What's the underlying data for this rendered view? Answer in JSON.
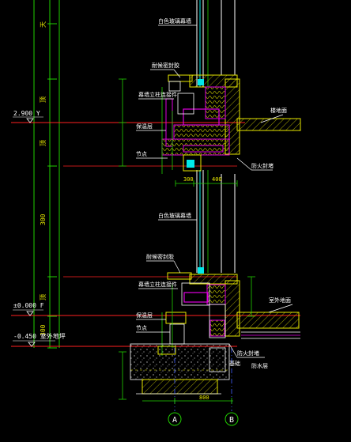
{
  "elevations": {
    "upper": "2.900 Y",
    "middle": "±0.000 F",
    "lower": "-0.450 室外地坪"
  },
  "axes": [
    "A",
    "B"
  ],
  "labels": {
    "glass_top": "白色玻璃幕墙",
    "glass_mid": "白色玻璃幕墙",
    "sealant_top": "耐候密封胶",
    "sealant_bottom": "耐候密封胶",
    "bracket_top": "幕墙立柱连接件",
    "bracket_bottom": "幕墙立柱连接件",
    "insulation_top": "保温层",
    "insulation_bottom": "保温层",
    "joint_top": "节点",
    "joint_bottom": "节点",
    "fire_top": "防火封堵",
    "fire_bottom": "防火封堵",
    "slab_finish": "楼地面",
    "ground_finish": "室外地面",
    "pit": "防水层",
    "base_note": "基础"
  },
  "dims": {
    "left_col": [
      "天",
      "顶",
      "顶",
      "300",
      "顶",
      "300",
      "顶"
    ],
    "mid": [
      "300",
      "400"
    ],
    "bottom": "800"
  },
  "colors": {
    "background": "#000000",
    "green": "#21d000",
    "yellow": "#e6e600",
    "magenta": "#e000e0",
    "red": "#ff2020",
    "cyan": "#00e8e8",
    "white": "#ffffff",
    "blue": "#4060ff"
  }
}
